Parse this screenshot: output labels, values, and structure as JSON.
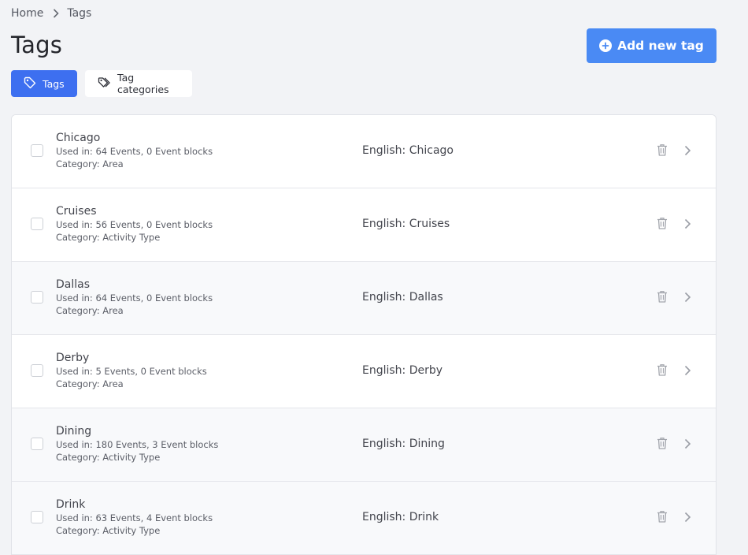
{
  "breadcrumb": {
    "home": "Home",
    "current": "Tags"
  },
  "page": {
    "title": "Tags",
    "add_button": "Add new tag"
  },
  "tabs": [
    {
      "label": "Tags",
      "icon": "tag-icon",
      "active": true
    },
    {
      "label": "Tag categories",
      "icon": "tag-icon",
      "active": false
    }
  ],
  "colors": {
    "accent": "#4a8af4",
    "active_tab": "#3d6ff0",
    "background": "#f2f3f6"
  },
  "tags": [
    {
      "name": "Chicago",
      "used_in": "Used in: 64 Events, 0 Event blocks",
      "category": "Category: Area",
      "translation": "English: Chicago"
    },
    {
      "name": "Cruises",
      "used_in": "Used in: 56 Events, 0 Event blocks",
      "category": "Category: Activity Type",
      "translation": "English: Cruises"
    },
    {
      "name": "Dallas",
      "used_in": "Used in: 64 Events, 0 Event blocks",
      "category": "Category: Area",
      "translation": "English: Dallas"
    },
    {
      "name": "Derby",
      "used_in": "Used in: 5 Events, 0 Event blocks",
      "category": "Category: Area",
      "translation": "English: Derby"
    },
    {
      "name": "Dining",
      "used_in": "Used in: 180 Events, 3 Event blocks",
      "category": "Category: Activity Type",
      "translation": "English: Dining"
    },
    {
      "name": "Drink",
      "used_in": "Used in: 63 Events, 4 Event blocks",
      "category": "Category: Activity Type",
      "translation": "English: Drink"
    }
  ]
}
